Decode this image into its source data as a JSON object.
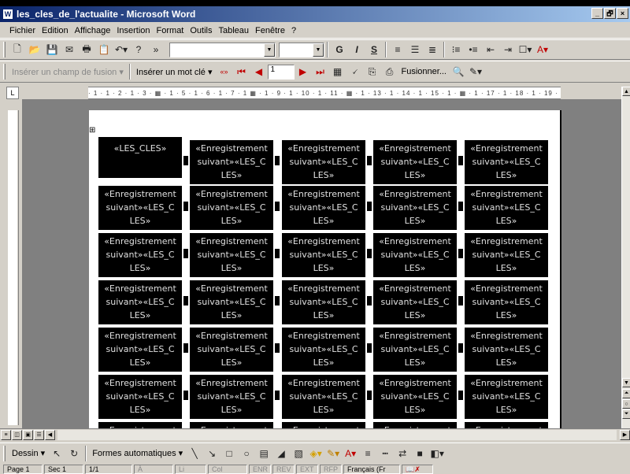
{
  "window": {
    "title": "les_cles_de_l'actualite - Microsoft Word",
    "minimize": "_",
    "restore": "🗗",
    "close": "×"
  },
  "menu": [
    "Fichier",
    "Edition",
    "Affichage",
    "Insertion",
    "Format",
    "Outils",
    "Tableau",
    "Fenêtre",
    "?"
  ],
  "format_toolbar": {
    "bold": "G",
    "italic": "I",
    "underline": "S"
  },
  "mailmerge_toolbar": {
    "insert_merge_field": "Insérer un champ de fusion ▾",
    "insert_word": "Insérer un mot clé ▾",
    "record_number": "1",
    "merge": "Fusionner..."
  },
  "ruler": {
    "corner": "L",
    "ticks": "· 1 · 1 · 2 · 1 · 3 · ▦ · 1 · 5 · 1 · 6 · 1 · 7 · 1 ▦ · 1 · 9 · 1 · 10 · 1 · 11 · ▦ · 1 · 13 · 1 · 14 · 1 · 15 · 1 · ▦ · 1 · 17 · 1 · 18 · 1 · 19 · 1 · 2"
  },
  "labels": {
    "first": "«LES_CLES»",
    "next": "«Enregistrement\nsuivant»«LES_C\nLES»",
    "truncated": "«Enregistrement"
  },
  "drawing_toolbar": {
    "draw": "Dessin ▾",
    "autoshapes": "Formes automatiques ▾"
  },
  "status": {
    "page": "Page 1",
    "section": "Sec 1",
    "pages": "1/1",
    "at": "À",
    "line": "Li",
    "col": "Col",
    "rec": "ENR",
    "rev": "REV",
    "ext": "EXT",
    "ovr": "RFP",
    "language": "Français (Fr"
  },
  "colors": {
    "title_start": "#0a246a",
    "title_end": "#a6caf0",
    "label_bg": "#000000",
    "label_text": "#e0e0e0"
  }
}
